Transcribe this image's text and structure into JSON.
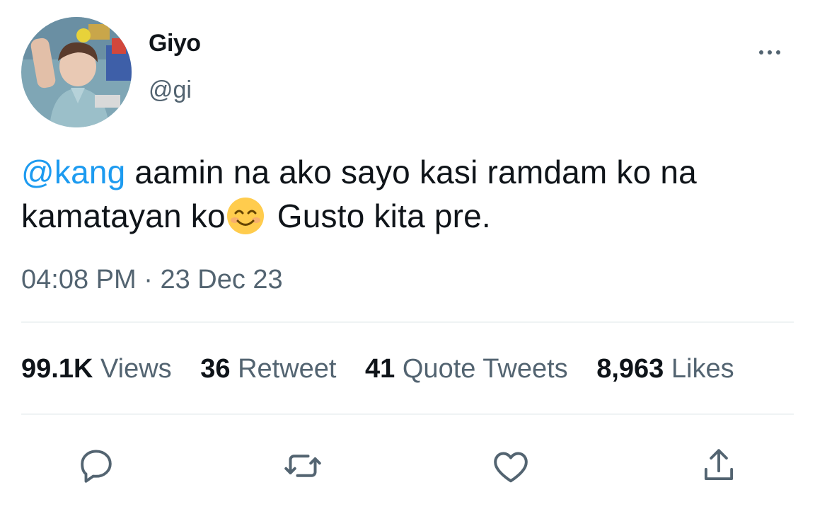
{
  "author": {
    "display_name": "Giyo",
    "handle": "@gi"
  },
  "tweet": {
    "mention": "@kang",
    "text_line1": " aamin na ako sayo kasi ramdam ko na",
    "text_line2_before_emoji": "kamatayan ko",
    "emoji": "smiling-face-with-smiling-eyes",
    "text_line2_after_emoji": " Gusto kita pre.",
    "time": "04:08 PM",
    "separator": "·",
    "date": "23 Dec 23"
  },
  "stats": [
    {
      "value": "99.1K",
      "label": "Views"
    },
    {
      "value": "36",
      "label": "Retweet"
    },
    {
      "value": "41",
      "label": "Quote Tweets"
    },
    {
      "value": "8,963",
      "label": "Likes"
    }
  ],
  "actions": [
    "reply-icon",
    "retweet-icon",
    "like-icon",
    "share-icon"
  ],
  "colors": {
    "mention": "#1d9bf0",
    "secondary_text": "#536471",
    "primary_text": "#0f1419",
    "divider": "#eff3f4"
  }
}
